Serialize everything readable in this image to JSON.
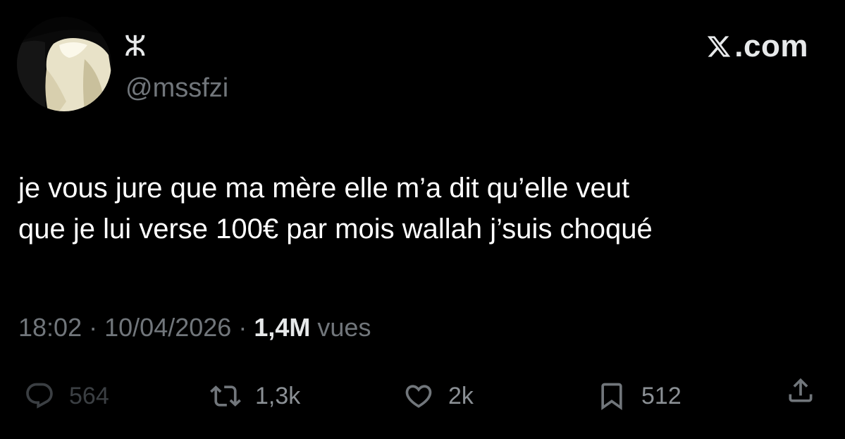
{
  "author": {
    "display_name": "ⵣ",
    "handle": "@mssfzi"
  },
  "brand": {
    "text": ".com",
    "icon": "x-logo-icon"
  },
  "tweet": {
    "lines": [
      "je vous jure que ma mère elle m’a dit qu’elle veut",
      "que je lui verse 100€ par mois wallah j’suis choqué"
    ]
  },
  "meta": {
    "time": "18:02",
    "separator": "·",
    "date": "10/04/2026",
    "views_count": "1,4M",
    "views_label": "vues"
  },
  "actions": {
    "replies": "564",
    "reposts": "1,3k",
    "likes": "2k",
    "bookmarks": "512"
  },
  "colors": {
    "background": "#000000",
    "primary_text": "#e7e9ea",
    "secondary_text": "#71767b"
  }
}
